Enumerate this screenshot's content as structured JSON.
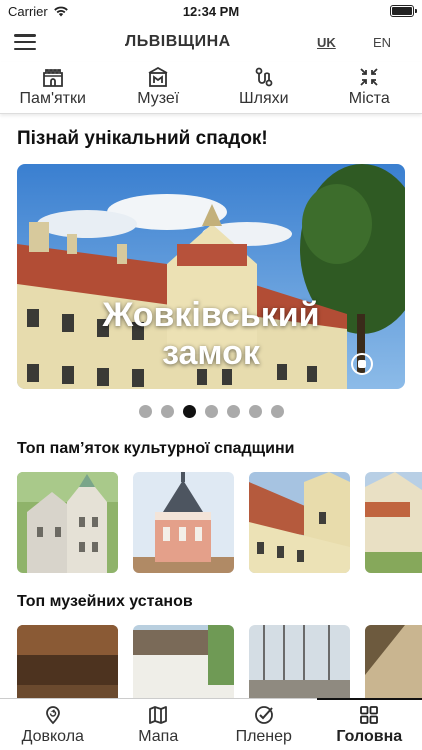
{
  "status_bar": {
    "carrier": "Carrier",
    "time": "12:34 PM"
  },
  "header": {
    "title": "ЛЬВІВЩИНА",
    "languages": [
      {
        "code": "UK",
        "active": true
      },
      {
        "code": "EN",
        "active": false
      }
    ]
  },
  "categories": [
    {
      "label": "Пам'ятки",
      "icon": "castle-icon"
    },
    {
      "label": "Музеї",
      "icon": "museum-icon"
    },
    {
      "label": "Шляхи",
      "icon": "route-icon"
    },
    {
      "label": "Міста",
      "icon": "collapse-icon"
    }
  ],
  "hero": {
    "heading": "Пізнай унікальний спадок!",
    "caption_line1": "Жовківський",
    "caption_line2": "замок",
    "dots_count": 7,
    "active_dot": 2
  },
  "lists": {
    "heritage_title": "Топ пам’яток культурної спадщини",
    "museums_title": "Топ музейних установ"
  },
  "bottom_nav": [
    {
      "label": "Довкола",
      "icon": "location-refresh-icon",
      "active": false
    },
    {
      "label": "Мапа",
      "icon": "map-icon",
      "active": false
    },
    {
      "label": "Пленер",
      "icon": "check-circle-icon",
      "active": false
    },
    {
      "label": "Головна",
      "icon": "grid-icon",
      "active": true
    }
  ],
  "colors": {
    "accent": "#111111",
    "inactive_dot": "#aaaaaa",
    "sky": "#4a8fd6"
  }
}
